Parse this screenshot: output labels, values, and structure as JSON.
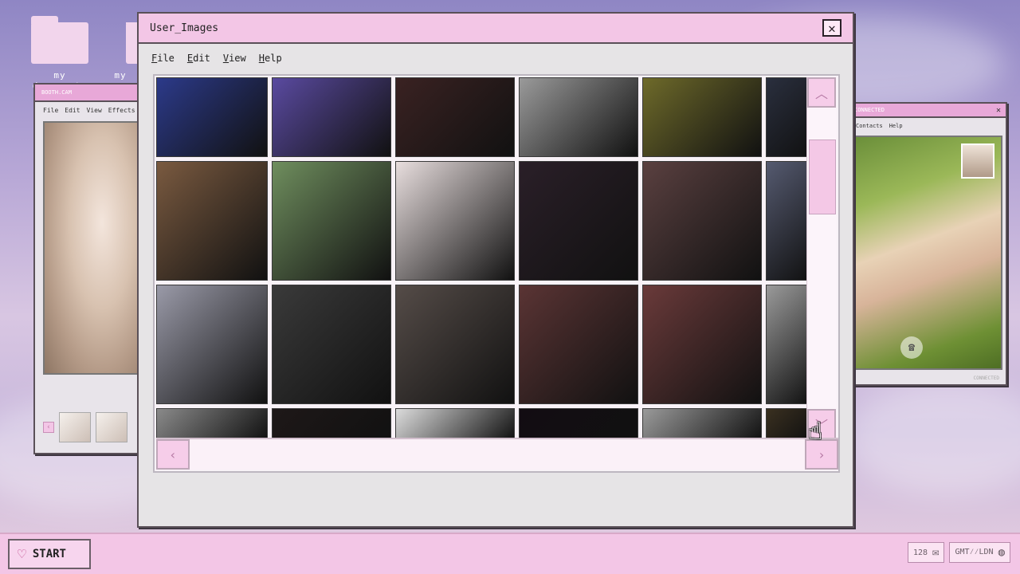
{
  "desktop": {
    "icons": [
      {
        "label": "my documents"
      },
      {
        "label": "my"
      }
    ]
  },
  "booth_window": {
    "title": "BOOTH.CAM",
    "menu": [
      "File",
      "Edit",
      "View",
      "Effects"
    ]
  },
  "call_window": {
    "title": "CONNECTED",
    "menu": [
      "Contacts",
      "Help"
    ],
    "status": "CONNECTED"
  },
  "main_window": {
    "title": "User_Images",
    "close_label": "✕",
    "menu": [
      "File",
      "Edit",
      "View",
      "Help"
    ],
    "scroll": {
      "up": "︿",
      "down": "﹀",
      "left": "‹",
      "right": "›"
    }
  },
  "gallery": {
    "thumbnails": [
      {
        "alt": "photo-01",
        "color": "#2c3a8a"
      },
      {
        "alt": "photo-02",
        "color": "#5a4aa0"
      },
      {
        "alt": "photo-03",
        "color": "#3a2222"
      },
      {
        "alt": "photo-04",
        "color": "#9a9a9a"
      },
      {
        "alt": "photo-05",
        "color": "#6e6a2a"
      },
      {
        "alt": "photo-06",
        "color": "#2a2f3e"
      },
      {
        "alt": "photo-07",
        "color": "#7a5a40"
      },
      {
        "alt": "photo-08",
        "color": "#6f8e5e"
      },
      {
        "alt": "photo-09",
        "color": "#e8dede"
      },
      {
        "alt": "photo-10",
        "color": "#2a1f28"
      },
      {
        "alt": "photo-11",
        "color": "#5a4040"
      },
      {
        "alt": "photo-12",
        "color": "#555a70"
      },
      {
        "alt": "photo-13",
        "color": "#9a9aa8"
      },
      {
        "alt": "photo-14",
        "color": "#3a3a3a"
      },
      {
        "alt": "photo-15",
        "color": "#554c48"
      },
      {
        "alt": "photo-16",
        "color": "#5a3434"
      },
      {
        "alt": "photo-17",
        "color": "#6a3a3a"
      },
      {
        "alt": "photo-18",
        "color": "#9a9a9a"
      },
      {
        "alt": "photo-19",
        "color": "#8a8a8a"
      },
      {
        "alt": "photo-20",
        "color": "#1e1818"
      },
      {
        "alt": "photo-21",
        "color": "#dcdcdc"
      },
      {
        "alt": "photo-22",
        "color": "#120c12"
      },
      {
        "alt": "photo-23",
        "color": "#9a9a9a"
      },
      {
        "alt": "photo-24",
        "color": "#3a3020"
      }
    ]
  },
  "taskbar": {
    "start_label": "START",
    "tray": {
      "count": "128",
      "timezone": "GMT⁄⁄LDN"
    }
  }
}
